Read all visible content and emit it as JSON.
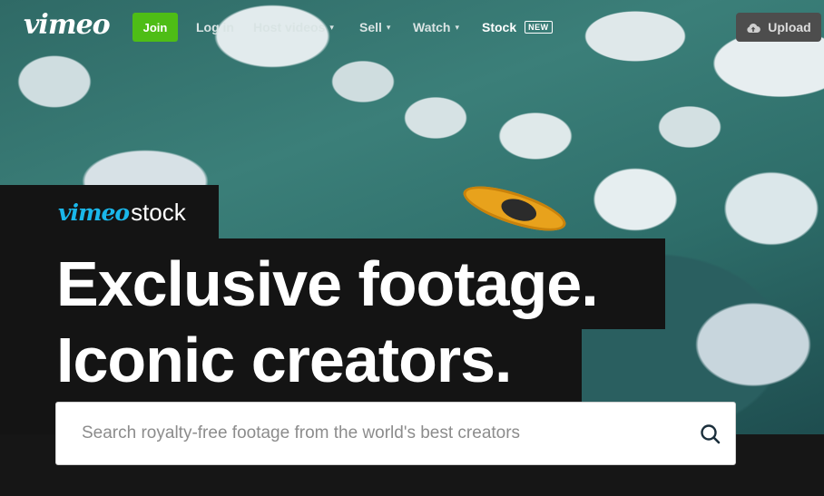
{
  "nav": {
    "logo": "vimeo",
    "join_label": "Join",
    "login_label": "Log in",
    "host_videos_label": "Host videos",
    "sell_label": "Sell",
    "watch_label": "Watch",
    "stock_label": "Stock",
    "new_badge": "NEW",
    "upload_label": "Upload",
    "dropdown_chevron": "▾"
  },
  "brand": {
    "vimeo": "vimeo",
    "stock": "stock"
  },
  "hero": {
    "headline_line1": "Exclusive footage.",
    "headline_line2": "Iconic creators."
  },
  "search": {
    "placeholder": "Search royalty-free footage from the world's best creators",
    "value": ""
  },
  "colors": {
    "join_green": "#4ebd16",
    "vimeo_blue": "#1ab7ea",
    "dark": "#141414"
  },
  "icons": {
    "upload": "cloud-upload-icon",
    "search": "search-icon",
    "chevron": "chevron-down-icon"
  }
}
